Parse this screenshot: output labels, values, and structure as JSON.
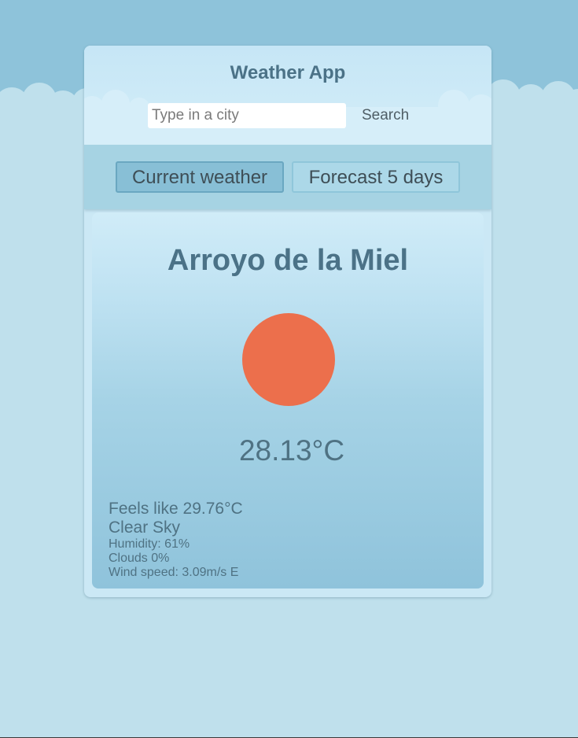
{
  "header": {
    "title": "Weather App",
    "search_placeholder": "Type in a city",
    "search_value": "",
    "search_button": "Search"
  },
  "tabs": [
    {
      "label": "Current weather",
      "active": true
    },
    {
      "label": "Forecast 5 days",
      "active": false
    }
  ],
  "current": {
    "city": "Arroyo de la Miel",
    "icon": "sun-icon",
    "temperature": "28.13°C",
    "feels_like": "Feels like 29.76°C",
    "description": "Clear Sky",
    "humidity": "Humidity: 61%",
    "clouds": "Clouds 0%",
    "wind": "Wind speed: 3.09m/s E"
  },
  "colors": {
    "sky": "#8ec3da",
    "background": "#bfe0ec",
    "sun": "#ec6f4c",
    "text": "#4b7287"
  }
}
